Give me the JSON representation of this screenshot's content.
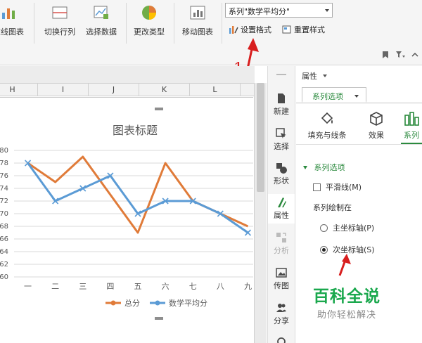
{
  "ribbon": {
    "buttons": {
      "line_chart": "在线图表",
      "switch_row_col": "切换行列",
      "select_data": "选择数据",
      "change_type": "更改类型",
      "move_chart": "移动图表"
    },
    "series_select": {
      "value": "系列\"数学平均分\""
    },
    "format_button": "设置格式",
    "reset_style_button": "重置样式"
  },
  "annotation": {
    "step_number": "1"
  },
  "sheet": {
    "columns": [
      "H",
      "I",
      "J",
      "K",
      "L"
    ]
  },
  "chart_data": {
    "type": "line",
    "title": "图表标题",
    "categories": [
      "一",
      "二",
      "三",
      "四",
      "五",
      "六",
      "七",
      "八",
      "九"
    ],
    "y_ticks": [
      "80",
      "78",
      "76",
      "74",
      "72",
      "70",
      "68",
      "66",
      "64",
      "62",
      "60"
    ],
    "ylim": [
      60,
      80
    ],
    "grid": true,
    "legend_position": "bottom",
    "series": [
      {
        "name": "总分",
        "color": "#e07b39",
        "values": [
          78,
          75,
          79,
          73,
          67,
          78,
          72,
          70,
          68
        ]
      },
      {
        "name": "数学平均分",
        "color": "#5b9bd5",
        "values": [
          78,
          72,
          74,
          76,
          70,
          72,
          72,
          70,
          67
        ]
      }
    ]
  },
  "sidebar": {
    "items": [
      {
        "label": "新建",
        "icon": "new-icon"
      },
      {
        "label": "选择",
        "icon": "select-cursor-icon"
      },
      {
        "label": "形状",
        "icon": "shapes-icon"
      },
      {
        "label": "属性",
        "icon": "properties-icon"
      },
      {
        "label": "分析",
        "icon": "analysis-icon"
      },
      {
        "label": "传图",
        "icon": "upload-image-icon"
      },
      {
        "label": "分享",
        "icon": "share-icon"
      }
    ]
  },
  "pane": {
    "title": "属性",
    "tab": "系列选项",
    "subtabs": [
      "填充与线条",
      "效果",
      "系列"
    ],
    "section": "系列选项",
    "smooth_line": "平滑线(M)",
    "plot_on_label": "系列绘制在",
    "primary_axis": "主坐标轴(P)",
    "secondary_axis": "次坐标轴(S)"
  },
  "watermark": {
    "main": "百科全说",
    "sub": "助你轻松解决"
  },
  "colors": {
    "accent_green": "#2b8a3e",
    "annotation_red": "#d81e1e"
  }
}
